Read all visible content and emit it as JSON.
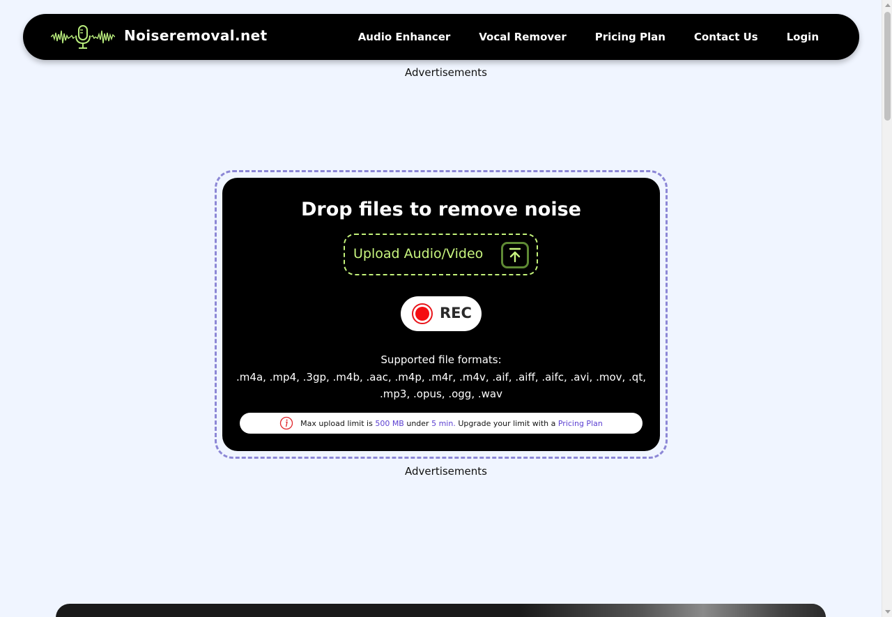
{
  "nav": {
    "brand": "Noiseremoval.net",
    "links": [
      "Audio Enhancer",
      "Vocal Remover",
      "Pricing Plan",
      "Contact Us",
      "Login"
    ],
    "logo_icon": "microphone-waveform-icon"
  },
  "ads": {
    "top_label": "Advertisements",
    "bottom_label": "Advertisements"
  },
  "dropzone": {
    "title": "Drop files to remove noise",
    "upload_label": "Upload Audio/Video",
    "upload_icon": "upload-arrow-icon",
    "rec_label": "REC",
    "formats_title": "Supported file formats:",
    "formats_list": ".m4a, .mp4, .3gp, .m4b, .aac, .m4p, .m4r, .m4v, .aif, .aiff, .aifc, .avi, .mov, .qt, .mp3, .opus, .ogg, .wav",
    "limit": {
      "text_1": "Max upload limit is",
      "size": "500 MB",
      "text_2": "under",
      "duration": "5 min.",
      "text_3": "Upgrade your limit with a",
      "link": "Pricing Plan"
    }
  },
  "colors": {
    "background": "#f0f5ff",
    "navbar": "#000000",
    "upload_accent": "#c8f57f",
    "dropzone_border": "#8c87d6",
    "rec_red": "#f50e12",
    "link_accent": "#5b3fd1"
  }
}
